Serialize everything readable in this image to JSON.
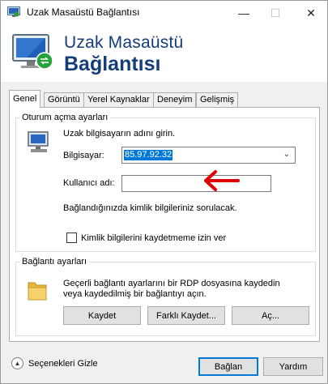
{
  "window": {
    "title": "Uzak Masaüstü Bağlantısı"
  },
  "titlebar": {
    "minimize": "—",
    "maximize": "☐",
    "close": "✕"
  },
  "banner": {
    "line1": "Uzak Masaüstü",
    "line2": "Bağlantısı"
  },
  "tabs": [
    {
      "label": "Genel",
      "active": true
    },
    {
      "label": "Görüntü",
      "active": false
    },
    {
      "label": "Yerel Kaynaklar",
      "active": false
    },
    {
      "label": "Deneyim",
      "active": false
    },
    {
      "label": "Gelişmiş",
      "active": false
    }
  ],
  "logon": {
    "legend": "Oturum açma ayarları",
    "instruction": "Uzak bilgisayarın adını girin.",
    "computer_label": "Bilgisayar:",
    "computer_value": "85.97.92.32",
    "username_label": "Kullanıcı adı:",
    "username_value": "",
    "prompt_text": "Bağlandığınızda kimlik bilgileriniz sorulacak.",
    "save_credentials_label": "Kimlik bilgilerini kaydetmeme izin ver",
    "save_credentials_checked": false
  },
  "connection": {
    "legend": "Bağlantı ayarları",
    "description": "Geçerli bağlantı ayarlarını bir RDP dosyasına kaydedin veya kaydedilmiş bir bağlantıyı açın.",
    "save_button": "Kaydet",
    "save_as_button": "Farklı Kaydet...",
    "open_button": "Aç..."
  },
  "footer": {
    "hide_options_label": "Seçenekleri Gizle",
    "connect_button": "Bağlan",
    "help_button": "Yardım"
  },
  "colors": {
    "accent": "#0078d7",
    "banner_text": "#153d7a",
    "arrow": "#e00000"
  },
  "icons": {
    "title": "remote-desktop-icon",
    "banner": "remote-desktop-monitor-icon",
    "logon": "computer-icon",
    "connection": "folder-icon",
    "options": "chevron-up-icon",
    "annotation": "red-arrow-left-icon"
  }
}
